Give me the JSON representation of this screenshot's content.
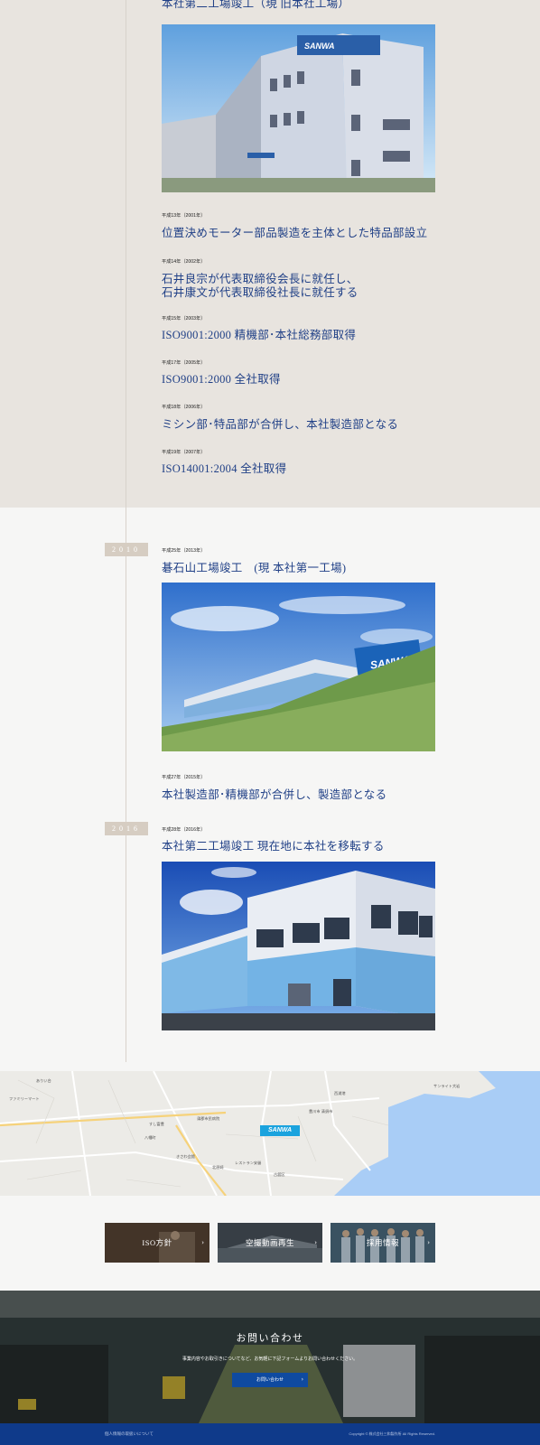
{
  "timeline": {
    "top_title": "本社第二工場竣工（現 旧本社工場）",
    "entries_top": [
      {
        "date": "平成13年（2001年）",
        "lines": [
          "位置決めモーター部品製造を主体とした特品部設立"
        ]
      },
      {
        "date": "平成14年（2002年）",
        "lines": [
          "石井良宗が代表取締役会長に就任し、",
          "石井康文が代表取締役社長に就任する"
        ]
      },
      {
        "date": "平成15年（2003年）",
        "lines": [
          "ISO9001:2000 精機部･本社総務部取得"
        ]
      },
      {
        "date": "平成17年（2005年）",
        "lines": [
          "ISO9001:2000 全社取得"
        ]
      },
      {
        "date": "平成18年（2006年）",
        "lines": [
          "ミシン部･特品部が合併し、本社製造部となる"
        ]
      },
      {
        "date": "平成19年（2007年）",
        "lines": [
          "ISO14001:2004 全社取得"
        ]
      }
    ],
    "decade_2010": "2010",
    "entry_2013": {
      "date": "平成25年（2013年）",
      "title": "碁石山工場竣工　(現 本社第一工場)"
    },
    "entry_2015": {
      "date": "平成27年（2015年）",
      "title": "本社製造部･精機部が合併し、製造部となる"
    },
    "decade_2016": "2016",
    "entry_2016": {
      "date": "平成28年（2016年）",
      "title": "本社第二工場竣工 現在地に本社を移転する"
    },
    "photo_sign_1": "SANWA",
    "photo_sign_2": "SANWA"
  },
  "map": {
    "pin_label": "SANWA",
    "labels": [
      "ありい台",
      "サンライト大岩",
      "豊川市 清須市",
      "すし富豊",
      "蒲郡市民病院",
      "八幡町",
      "古舘区",
      "きさわ会館",
      "レストラン安曇",
      "北原崎",
      "ファミリーマート",
      "西浦港"
    ]
  },
  "banners": [
    {
      "label": "ISO方針"
    },
    {
      "label": "空撮動画再生"
    },
    {
      "label": "採用情報"
    }
  ],
  "contact": {
    "title": "お問い合わせ",
    "text": "事業内容やお取引きについてなど、お気軽に下記フォームよりお問い合わせください。",
    "button": "お問い合わせ"
  },
  "footer": {
    "left": "個人情報の取扱いについて",
    "right": "Copyright © 株式会社三和製作所 All Rights Reserved."
  },
  "colors": {
    "accent": "#1f3f86",
    "footer": "#0f3a8a",
    "button": "#0f4aa0",
    "decade": "#d6cdc2",
    "pin": "#1ba3de"
  }
}
